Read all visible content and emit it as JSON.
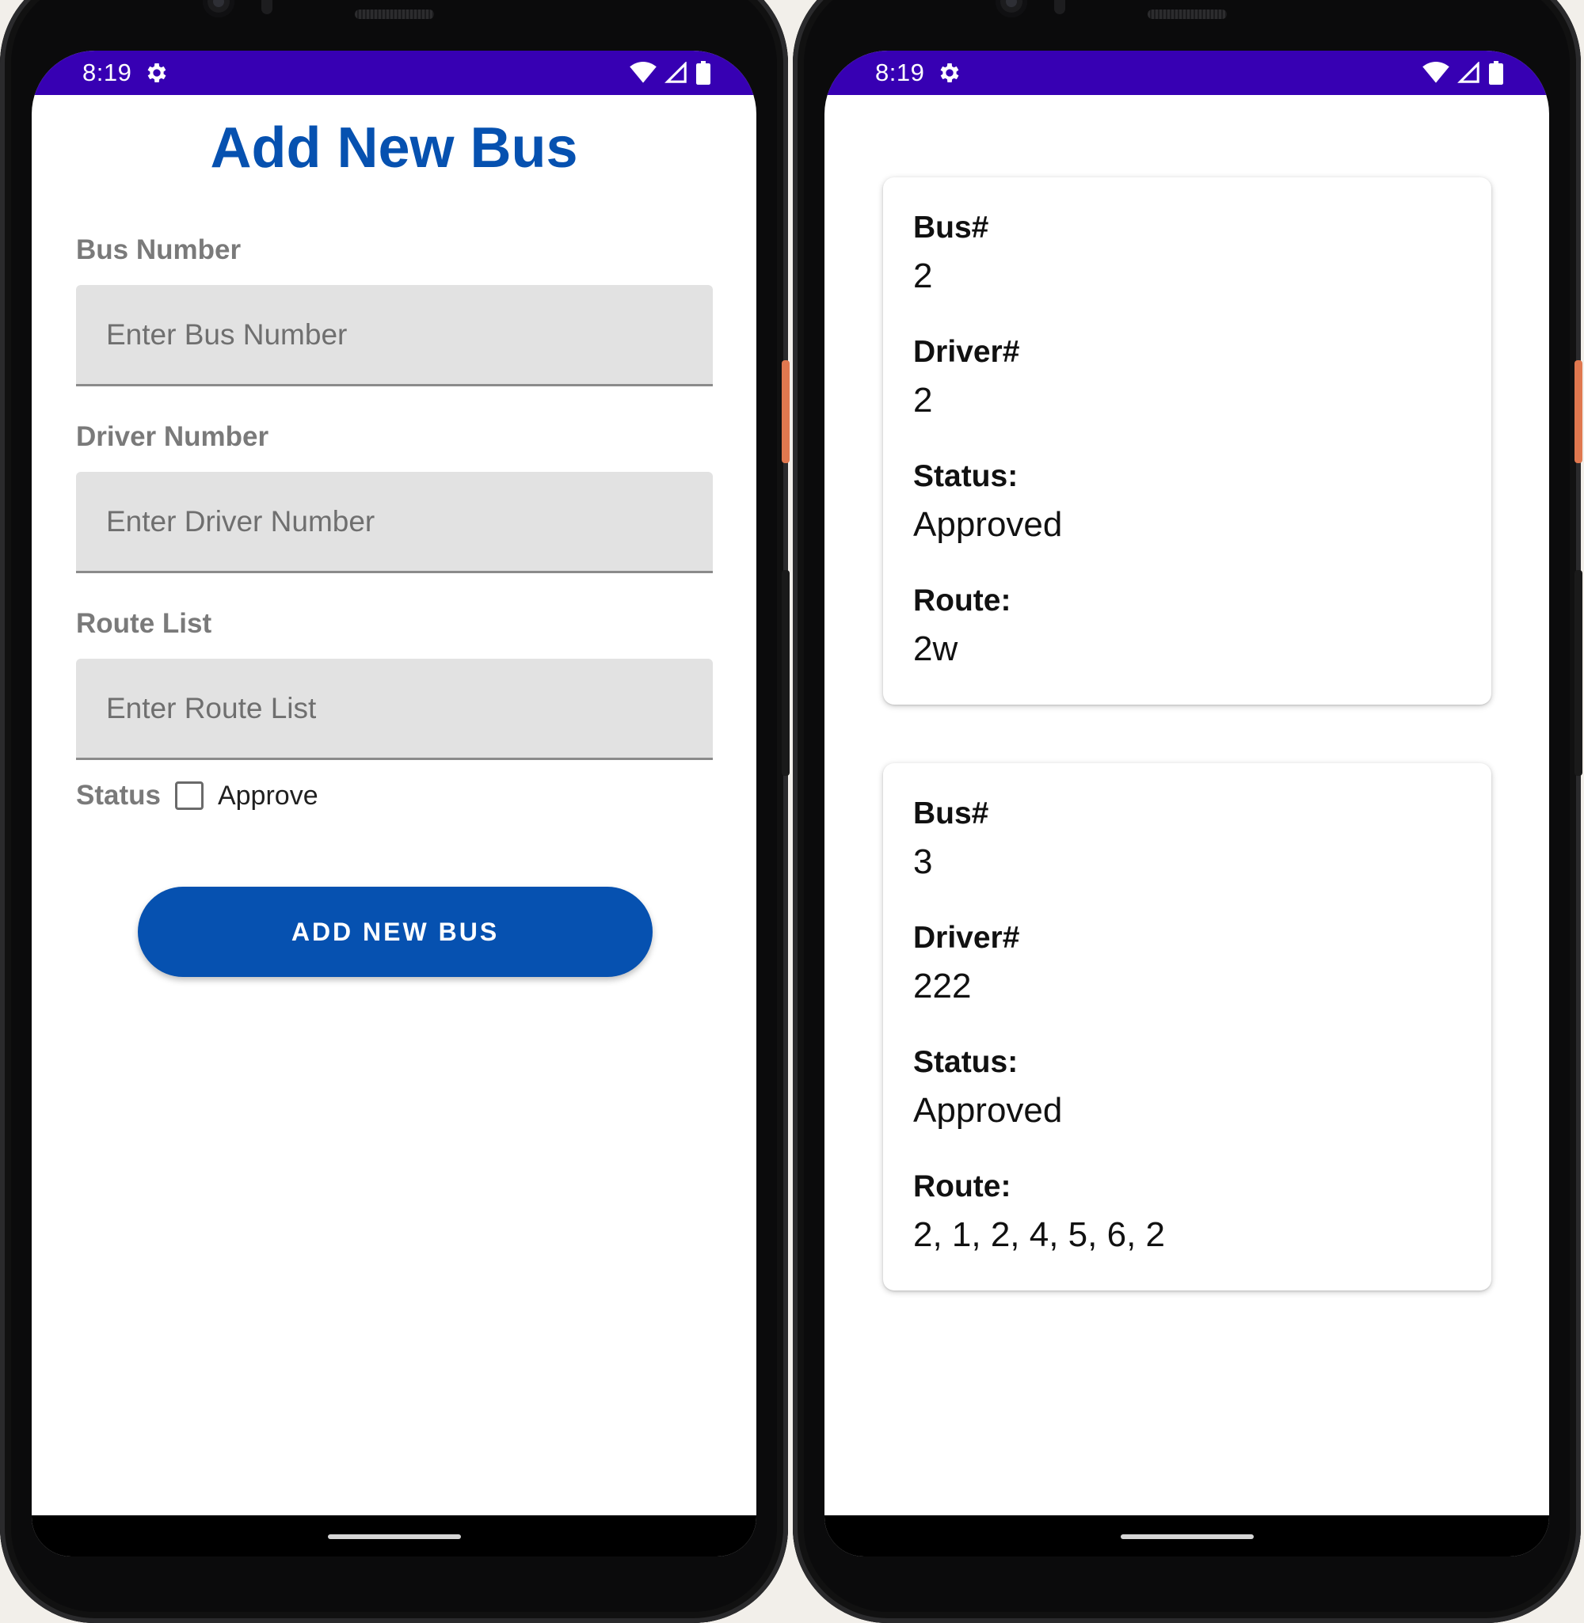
{
  "status_bar": {
    "time": "8:19"
  },
  "form_screen": {
    "title": "Add New Bus",
    "fields": [
      {
        "label": "Bus Number",
        "placeholder": "Enter Bus Number",
        "value": ""
      },
      {
        "label": "Driver Number",
        "placeholder": "Enter Driver Number",
        "value": ""
      },
      {
        "label": "Route List",
        "placeholder": "Enter Route List",
        "value": ""
      }
    ],
    "status_label": "Status",
    "approve_label": "Approve",
    "approve_checked": false,
    "submit_label": "ADD NEW BUS"
  },
  "list_screen": {
    "cards": [
      {
        "bus_label": "Bus#",
        "bus": "2",
        "driver_label": "Driver#",
        "driver": "2",
        "status_label": "Status:",
        "status": "Approved",
        "route_label": "Route:",
        "route": "2w"
      },
      {
        "bus_label": "Bus#",
        "bus": "3",
        "driver_label": "Driver#",
        "driver": "222",
        "status_label": "Status:",
        "status": "Approved",
        "route_label": "Route:",
        "route": "2, 1, 2, 4, 5, 6, 2"
      }
    ]
  },
  "colors": {
    "status_bar": "#3700b3",
    "primary": "#0651b0",
    "field_bg": "#e2e2e2",
    "label_gray": "#7a7a7a"
  },
  "icons": [
    "settings-gear-icon",
    "wifi-icon",
    "cell-signal-icon",
    "battery-icon"
  ]
}
